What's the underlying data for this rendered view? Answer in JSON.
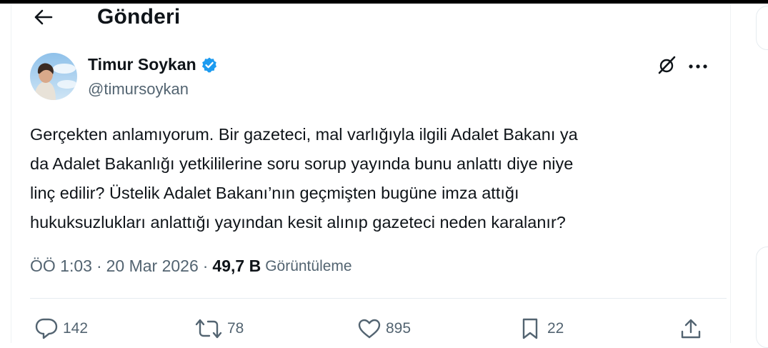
{
  "header": {
    "title": "Gönderi"
  },
  "author": {
    "name": "Timur Soykan",
    "handle": "@timursoykan"
  },
  "tweet": {
    "text": "Gerçekten anlamıyorum. Bir gazeteci, mal varlığıyla ilgili Adalet Bakanı ya\nda Adalet Bakanlığı yetkililerine soru sorup yayında bunu anlattı diye niye\nlinç edilir? Üstelik Adalet Bakanı’nın geçmişten bugüne imza attığı\nhukuksuzlukları anlattığı yayından  kesit alınıp gazeteci neden karalanır?"
  },
  "meta": {
    "time": "ÖÖ 1:03",
    "separator": "·",
    "date": "20 Mar 2026",
    "views_count": "49,7 B",
    "views_label": "Görüntüleme"
  },
  "actions": {
    "replies": "142",
    "reposts": "78",
    "likes": "895",
    "bookmarks": "22"
  },
  "icons": [
    "back-arrow-icon",
    "verified-badge-icon",
    "grok-icon",
    "more-icon",
    "reply-icon",
    "repost-icon",
    "like-icon",
    "bookmark-icon",
    "share-icon"
  ],
  "colors": {
    "verified": "#1d9bf0",
    "text": "#0f1419",
    "secondary": "#536471"
  }
}
